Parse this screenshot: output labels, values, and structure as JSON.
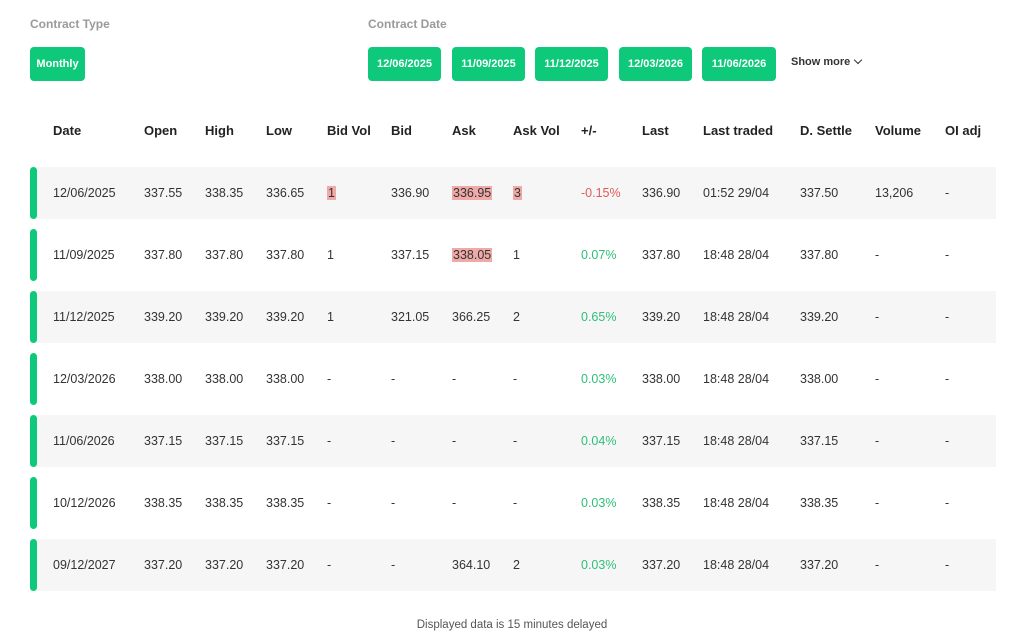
{
  "filters": {
    "contract_type_label": "Contract Type",
    "contract_type_button": "Monthly",
    "contract_date_label": "Contract Date",
    "date_buttons": [
      "12/06/2025",
      "11/09/2025",
      "11/12/2025",
      "12/03/2026",
      "11/06/2026"
    ],
    "show_more": "Show more"
  },
  "table": {
    "headers": [
      "Date",
      "Open",
      "High",
      "Low",
      "Bid Vol",
      "Bid",
      "Ask",
      "Ask Vol",
      "+/-",
      "Last",
      "Last traded",
      "D. Settle",
      "Volume",
      "OI adj"
    ],
    "rows": [
      [
        "12/06/2025",
        "337.55",
        "338.35",
        "336.65",
        "1",
        "336.90",
        "336.95",
        "3",
        "-0.15%",
        "336.90",
        "01:52 29/04",
        "337.50",
        "13,206",
        "-"
      ],
      [
        "11/09/2025",
        "337.80",
        "337.80",
        "337.80",
        "1",
        "337.15",
        "338.05",
        "1",
        "0.07%",
        "337.80",
        "18:48 28/04",
        "337.80",
        "-",
        "-"
      ],
      [
        "11/12/2025",
        "339.20",
        "339.20",
        "339.20",
        "1",
        "321.05",
        "366.25",
        "2",
        "0.65%",
        "339.20",
        "18:48 28/04",
        "339.20",
        "-",
        "-"
      ],
      [
        "12/03/2026",
        "338.00",
        "338.00",
        "338.00",
        "-",
        "-",
        "-",
        "-",
        "0.03%",
        "338.00",
        "18:48 28/04",
        "338.00",
        "-",
        "-"
      ],
      [
        "11/06/2026",
        "337.15",
        "337.15",
        "337.15",
        "-",
        "-",
        "-",
        "-",
        "0.04%",
        "337.15",
        "18:48 28/04",
        "337.15",
        "-",
        "-"
      ],
      [
        "10/12/2026",
        "338.35",
        "338.35",
        "338.35",
        "-",
        "-",
        "-",
        "-",
        "0.03%",
        "338.35",
        "18:48 28/04",
        "338.35",
        "-",
        "-"
      ],
      [
        "09/12/2027",
        "337.20",
        "337.20",
        "337.20",
        "-",
        "-",
        "364.10",
        "2",
        "0.03%",
        "337.20",
        "18:48 28/04",
        "337.20",
        "-",
        "-"
      ]
    ]
  },
  "footer": "Displayed data is 15 minutes delayed",
  "colors": {
    "accent": "#0ec97a",
    "positive": "#2fbf7a",
    "negative": "#e05a5a",
    "highlight": "#efaaa8"
  }
}
